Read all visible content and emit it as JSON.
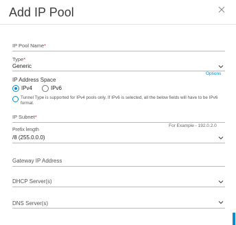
{
  "dialog": {
    "title": "Add IP Pool",
    "ip_pool_name": {
      "label": "IP Pool Name",
      "required_mark": "*",
      "value": ""
    },
    "type": {
      "label": "Type",
      "required_mark": "*",
      "value": "Generic"
    },
    "options_link": "Options",
    "address_space": {
      "label": "IP Address Space",
      "options": [
        {
          "label": "IPv4",
          "selected": true
        },
        {
          "label": "IPv6",
          "selected": false
        }
      ],
      "info_text": "Tunnel Type is supported for IPv4 pools only. If IPv6 is selected, all the below fields will have to be IPv6 format."
    },
    "ip_subnet": {
      "label": "IP Subnet",
      "required_mark": "*",
      "hint": "For Example - 192.0.2.0"
    },
    "prefix_length": {
      "label": "Prefix length",
      "value": "/8 (255.0.0.0)"
    },
    "gateway": {
      "label": "Gateway IP Address"
    },
    "dhcp": {
      "label": "DHCP Server(s)"
    },
    "dns": {
      "label": "DNS Server(s)"
    }
  },
  "colors": {
    "accent": "#0a8bd0",
    "required": "#d9292b"
  }
}
